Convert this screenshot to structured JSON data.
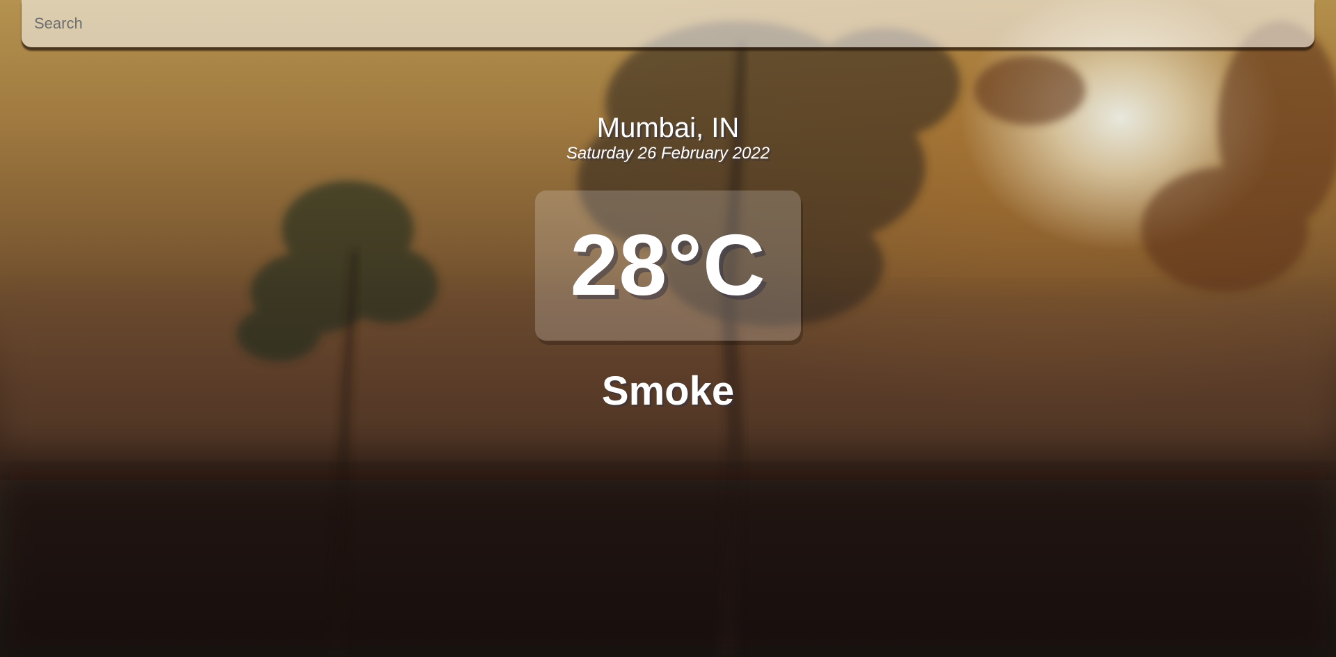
{
  "search": {
    "placeholder": "Search",
    "value": ""
  },
  "location": {
    "city_country": "Mumbai, IN",
    "date": "Saturday 26 February 2022"
  },
  "weather": {
    "temperature": "28°C",
    "condition": "Smoke"
  },
  "background": {
    "scene": "misty-sunrise-trees",
    "colors": [
      "#b4924f",
      "#7d5a32",
      "#2e1f17",
      "#1a120e"
    ]
  }
}
